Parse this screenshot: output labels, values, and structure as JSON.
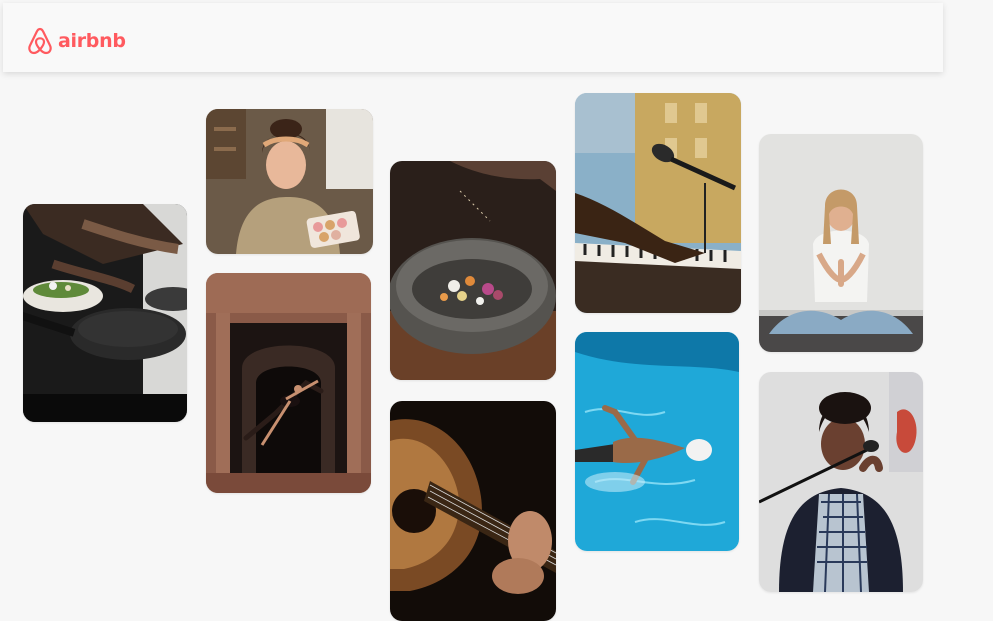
{
  "header": {
    "brand": "airbnb",
    "logo_icon": "airbnb-belo-icon",
    "brand_color": "#ff5a5f"
  },
  "gallery": [
    {
      "subject": "cooking-pan"
    },
    {
      "subject": "woman-holding-macarons"
    },
    {
      "subject": "dancer-in-archway"
    },
    {
      "subject": "spice-bowl"
    },
    {
      "subject": "acoustic-guitar"
    },
    {
      "subject": "piano-and-microphone"
    },
    {
      "subject": "swimmer-in-pool"
    },
    {
      "subject": "yoga-meditation"
    },
    {
      "subject": "singer-at-microphone"
    }
  ]
}
